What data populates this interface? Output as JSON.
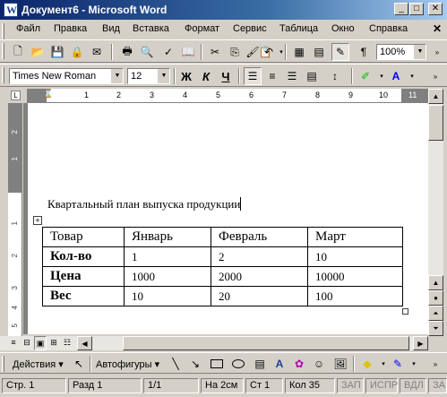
{
  "window": {
    "title": "Документ6 - Microsoft Word"
  },
  "menu": [
    "Файл",
    "Правка",
    "Вид",
    "Вставка",
    "Формат",
    "Сервис",
    "Таблица",
    "Окно",
    "Справка"
  ],
  "toolbar": {
    "zoom": "100%",
    "font_name": "Times New Roman",
    "font_size": "12",
    "bold": "Ж",
    "italic": "К",
    "underline": "Ч"
  },
  "ruler": {
    "marks": [
      "1",
      "2",
      "3",
      "4",
      "5",
      "6",
      "7",
      "8",
      "9",
      "10",
      "11"
    ]
  },
  "vruler": {
    "marks": [
      "2",
      "1",
      "1",
      "2",
      "3",
      "4",
      "5"
    ]
  },
  "document": {
    "heading": "Квартальный план выпуска продукции",
    "table": {
      "header": [
        "Товар",
        "Январь",
        "Февраль",
        "Март"
      ],
      "rows": [
        [
          "Кол-во",
          "1",
          "2",
          "10"
        ],
        [
          "Цена",
          "1000",
          "2000",
          "10000"
        ],
        [
          "Вес",
          "10",
          "20",
          "100"
        ]
      ]
    }
  },
  "drawing": {
    "actions": "Действия ▾",
    "autoshapes": "Автофигуры ▾"
  },
  "status": {
    "page": "Стр. 1",
    "section": "Разд 1",
    "pages": "1/1",
    "at": "На 2см",
    "line": "Ст 1",
    "column": "Кол 35",
    "rec": "ЗАП",
    "trk": "ИСПР",
    "ext": "ВДЛ",
    "ovr": "ЗАМ"
  },
  "colors": {
    "title_start": "#0a246a",
    "title_end": "#a6caf0",
    "face": "#d4d0c8",
    "highlight": "#00c000",
    "font_color": "#0000ff"
  }
}
